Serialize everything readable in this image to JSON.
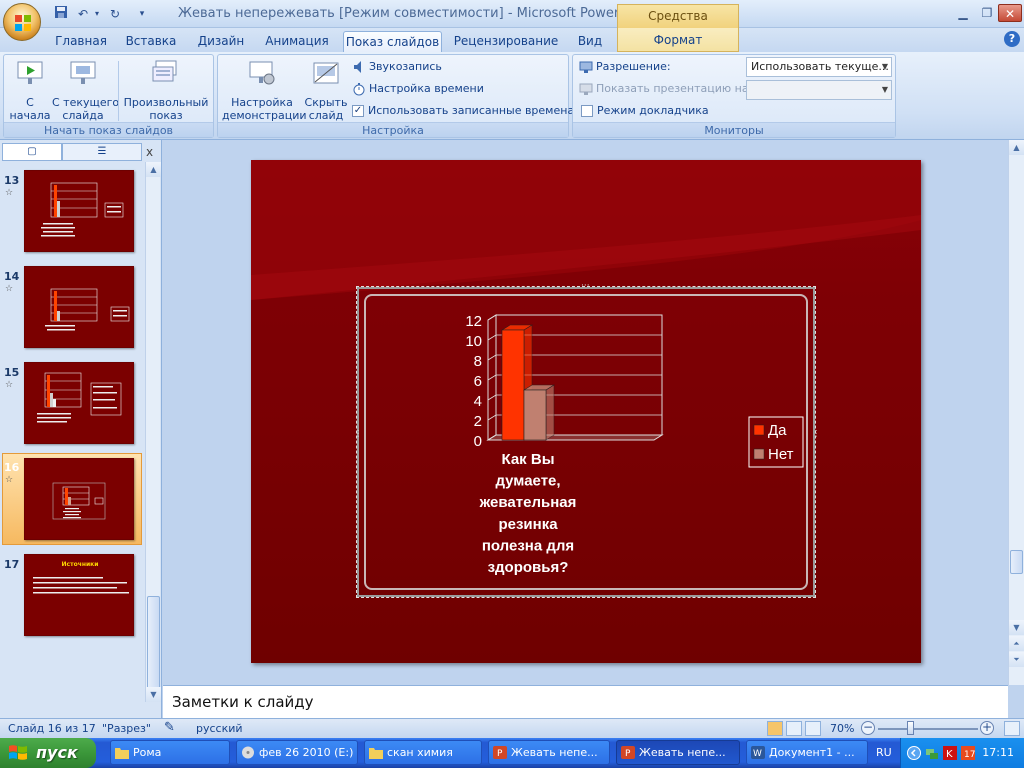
{
  "titlebar": {
    "title": "Жевать непережевать [Режим совместимости] - Microsoft PowerPo...",
    "context_tab": "Средства рисования",
    "qat_more": "▾"
  },
  "tabs": [
    "Главная",
    "Вставка",
    "Дизайн",
    "Анимация",
    "Показ слайдов",
    "Рецензирование",
    "Вид",
    "Формат"
  ],
  "ribbon": {
    "start_group": {
      "label": "Начать показ слайдов",
      "from_start": "С\nначала",
      "from_current": "С текущего\nслайда",
      "custom": "Произвольный\nпоказ"
    },
    "setup_group": {
      "label": "Настройка",
      "setup_show": "Настройка\nдемонстрации",
      "hide_slide": "Скрыть\nслайд",
      "record_narration": "Звукозапись",
      "rehearse": "Настройка времени",
      "use_timings": "Использовать записанные времена",
      "use_timings_checked": true
    },
    "monitors_group": {
      "label": "Мониторы",
      "resolution_label": "Разрешение:",
      "resolution_value": "Использовать текуще...",
      "show_on_label": "Показать презентацию на:",
      "show_on_value": "",
      "presenter_view": "Режим докладчика",
      "presenter_view_checked": false
    }
  },
  "pane": {
    "close": "x",
    "slides": [
      {
        "num": "13",
        "star": "☆"
      },
      {
        "num": "14",
        "star": "☆"
      },
      {
        "num": "15",
        "star": "☆"
      },
      {
        "num": "16",
        "star": "☆"
      },
      {
        "num": "17",
        "star": ""
      }
    ],
    "thumb17_title": "Источники"
  },
  "slide": {
    "chart_question_lines": [
      "Как Вы",
      "думаете,",
      "жевательная",
      "резинка",
      "полезна для",
      "здоровья?"
    ]
  },
  "chart_data": {
    "type": "bar",
    "title": "",
    "categories": [
      "Как Вы думаете, жевательная резинка полезна для здоровья?"
    ],
    "series": [
      {
        "name": "Да",
        "values": [
          11
        ],
        "color": "#ff3300"
      },
      {
        "name": "Нет",
        "values": [
          5
        ],
        "color": "#c08070"
      }
    ],
    "ylim": [
      0,
      12
    ],
    "yticks": [
      "0",
      "2",
      "4",
      "6",
      "8",
      "10",
      "12"
    ],
    "legend_position": "right",
    "grid": true,
    "style": "3d"
  },
  "notes": {
    "text": "Заметки к слайду"
  },
  "status": {
    "slide_info": "Слайд 16 из 17",
    "theme": "\"Разрез\"",
    "language": "русский",
    "zoom": "70%",
    "zoom_minus": "−",
    "zoom_plus": "+"
  },
  "taskbar": {
    "start": "пуск",
    "items": [
      "Рома",
      "фев 26 2010 (E:)",
      "скан химия",
      "Жевать непе...",
      "Жевать непе...",
      "Документ1 - ..."
    ],
    "lang": "RU",
    "clock": "17:11"
  },
  "colors": {
    "slide_bg": "#7a0000",
    "series_yes": "#ff3300",
    "series_no": "#c08070",
    "selected_thumb": "#f4a640"
  }
}
